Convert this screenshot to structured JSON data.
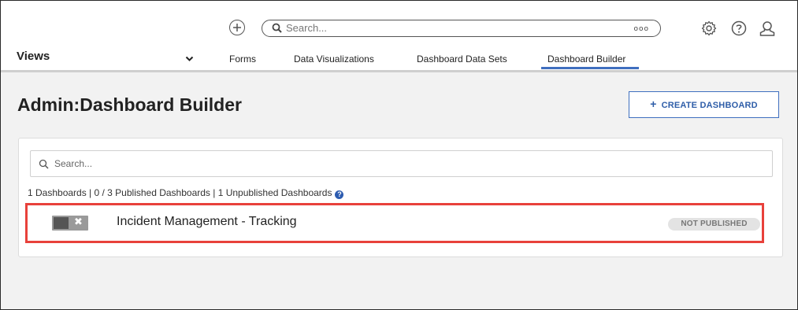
{
  "topbar": {
    "search_placeholder": "Search...",
    "dots": "ooo"
  },
  "nav": {
    "views_label": "Views",
    "tabs": [
      {
        "label": "Forms"
      },
      {
        "label": "Data Visualizations"
      },
      {
        "label": "Dashboard Data Sets"
      },
      {
        "label": "Dashboard Builder",
        "active": true
      }
    ]
  },
  "page": {
    "title": "Admin:Dashboard Builder",
    "create_button": "CREATE DASHBOARD"
  },
  "list": {
    "search_placeholder": "Search...",
    "summary": "1 Dashboards | 0 / 3 Published Dashboards | 1 Unpublished Dashboards",
    "help_glyph": "?",
    "items": [
      {
        "name": "Incident Management - Tracking",
        "status": "NOT PUBLISHED",
        "toggle_glyph": "✖"
      }
    ]
  },
  "colors": {
    "accent": "#3f6fbf",
    "highlight": "#e8413b"
  },
  "icons": [
    "add-circle-icon",
    "search-icon",
    "gear-icon",
    "help-icon",
    "user-icon",
    "chevron-down-icon",
    "help-circle-icon"
  ]
}
